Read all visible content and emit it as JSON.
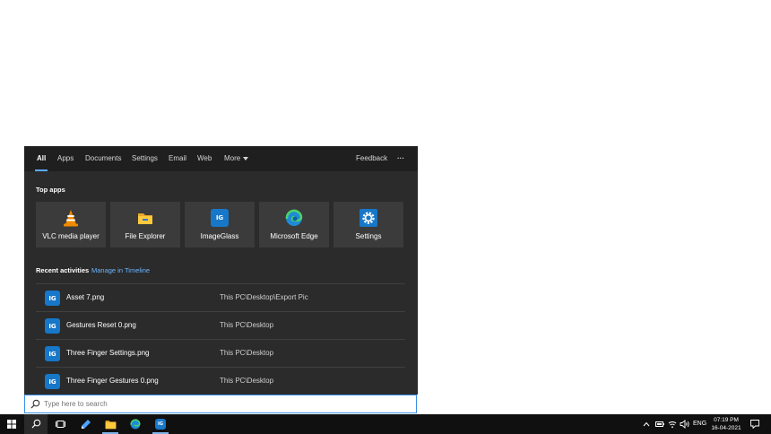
{
  "tabs": [
    {
      "label": "All",
      "active": true
    },
    {
      "label": "Apps"
    },
    {
      "label": "Documents"
    },
    {
      "label": "Settings"
    },
    {
      "label": "Email"
    },
    {
      "label": "Web"
    },
    {
      "label": "More"
    }
  ],
  "feedback_label": "Feedback",
  "more_options_label": "···",
  "top_apps": {
    "title": "Top apps",
    "items": [
      {
        "label": "VLC media player",
        "icon": "vlc-icon"
      },
      {
        "label": "File Explorer",
        "icon": "folder-icon"
      },
      {
        "label": "ImageGlass",
        "icon": "imageglass-icon"
      },
      {
        "label": "Microsoft Edge",
        "icon": "edge-icon"
      },
      {
        "label": "Settings",
        "icon": "gear-icon"
      }
    ]
  },
  "recent": {
    "title": "Recent activities",
    "manage_link": "Manage in Timeline",
    "items": [
      {
        "name": "Asset 7.png",
        "path": "This PC\\Desktop\\Export Pic"
      },
      {
        "name": "Gestures Reset 0.png",
        "path": "This PC\\Desktop"
      },
      {
        "name": "Three Finger Settings.png",
        "path": "This PC\\Desktop"
      },
      {
        "name": "Three Finger Gestures 0.png",
        "path": "This PC\\Desktop"
      }
    ]
  },
  "search": {
    "placeholder": "Type here to search"
  },
  "tray": {
    "language": "ENG",
    "time": "07:19 PM",
    "date": "16-04-2021"
  },
  "colors": {
    "accent": "#5aa9ff",
    "panel": "#2b2b2b",
    "tile": "#3b3b3b",
    "taskbar": "#101010"
  }
}
